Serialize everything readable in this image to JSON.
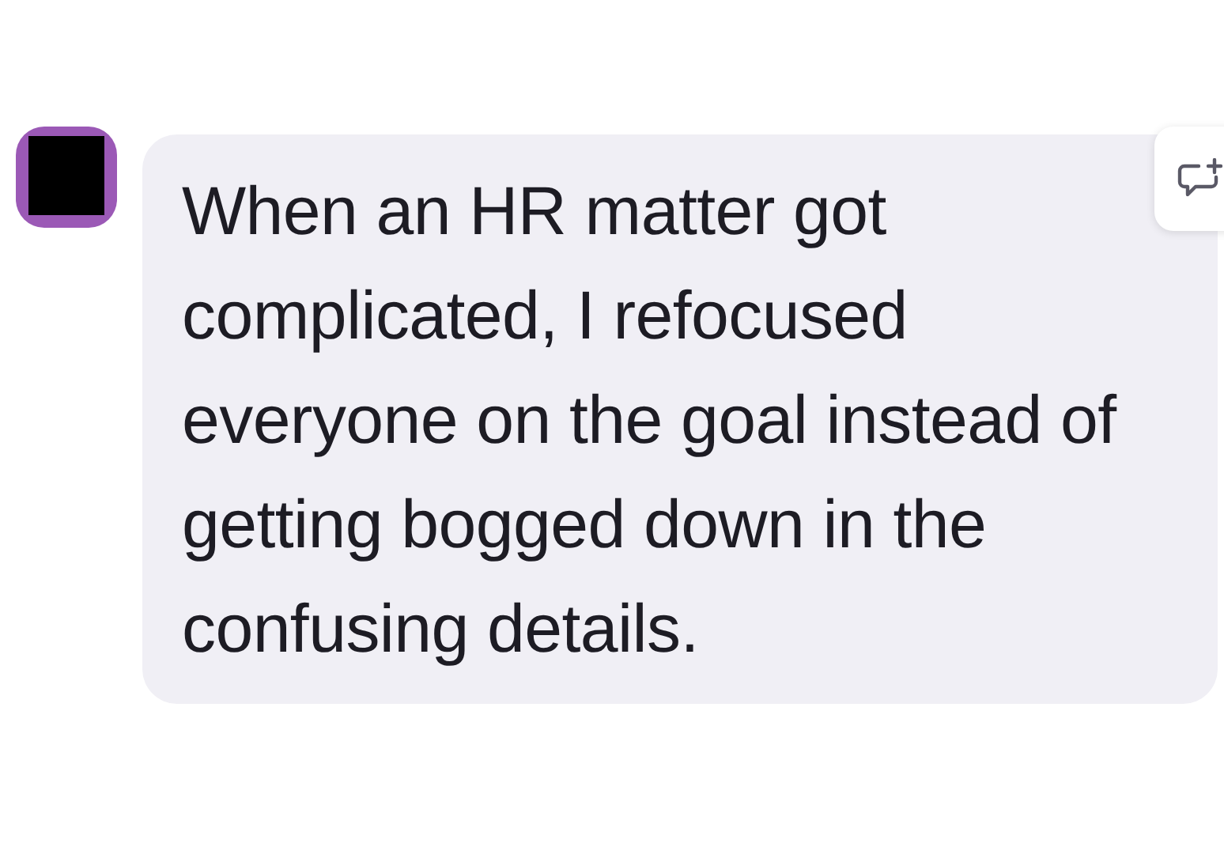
{
  "message": {
    "text": "When an HR matter got complicated, I refocused everyone on the goal instead of getting bogged down in the confusing details."
  }
}
